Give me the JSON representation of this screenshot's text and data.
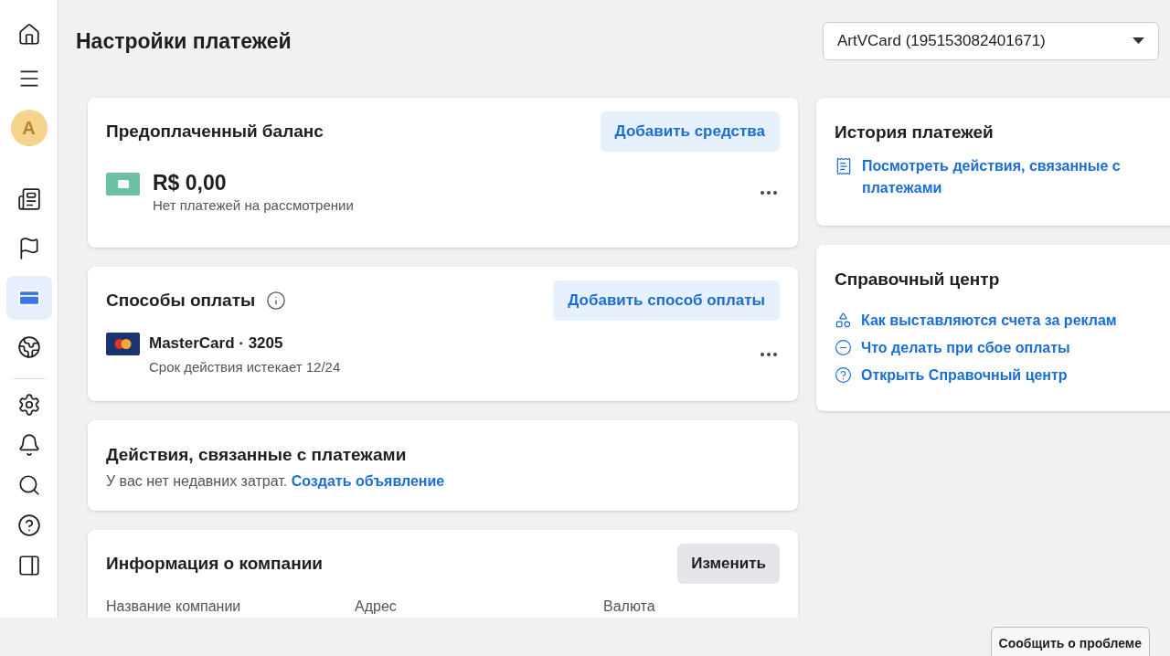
{
  "sidebar": {
    "avatar": "A",
    "items": [
      {
        "selected": false
      },
      {
        "selected": false
      },
      {
        "selected": false
      },
      {
        "selected": false
      },
      {
        "selected": true
      },
      {
        "selected": false
      }
    ],
    "bottom_items": [
      {
        "selected": false
      },
      {
        "selected": false
      },
      {
        "selected": false
      },
      {
        "selected": false
      },
      {
        "selected": false
      }
    ]
  },
  "page": {
    "title": "Настройки платежей",
    "account_select": "ArtVCard (195153082401671)"
  },
  "prepaid": {
    "title": "Предоплаченный баланс",
    "button": "Добавить средства",
    "amount": "R$ 0,00",
    "note": "Нет платежей на рассмотрении"
  },
  "payment_methods": {
    "title": "Способы оплаты",
    "button": "Добавить способ оплаты",
    "card": "MasterCard · 3205",
    "expiry": "Срок действия истекает 12/24"
  },
  "activity": {
    "title": "Действия, связанные с платежами",
    "text": "У вас нет недавних затрат.",
    "link": "Создать объявление"
  },
  "company": {
    "title": "Информация о компании",
    "button": "Изменить",
    "columns": [
      "Название компании",
      "Адрес",
      "Валюта"
    ]
  },
  "history": {
    "title": "История платежей",
    "link": "Посмотреть действия, связанные с платежами"
  },
  "help": {
    "title": "Справочный центр",
    "links": [
      "Как выставляются счета за реклам",
      "Что делать при сбое оплаты",
      "Открыть Справочный центр"
    ]
  },
  "report_button": "Сообщить о проблеме"
}
